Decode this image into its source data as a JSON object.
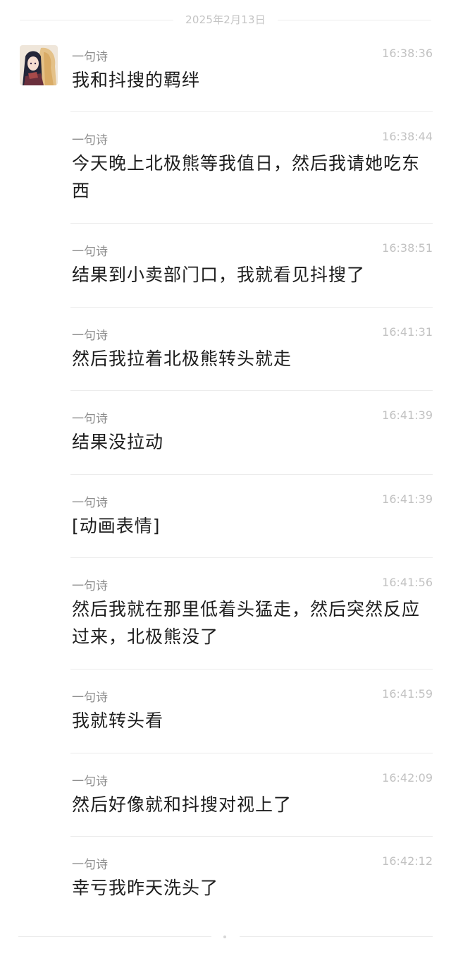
{
  "date_separator": "2025年2月13日",
  "messages": [
    {
      "sender": "一句诗",
      "time": "16:38:36",
      "text": "我和抖搜的羁绊"
    },
    {
      "sender": "一句诗",
      "time": "16:38:44",
      "text": "今天晚上北极熊等我值日，然后我请她吃东西"
    },
    {
      "sender": "一句诗",
      "time": "16:38:51",
      "text": "结果到小卖部门口，我就看见抖搜了"
    },
    {
      "sender": "一句诗",
      "time": "16:41:31",
      "text": "然后我拉着北极熊转头就走"
    },
    {
      "sender": "一句诗",
      "time": "16:41:39",
      "text": "结果没拉动"
    },
    {
      "sender": "一句诗",
      "time": "16:41:39",
      "text": "[动画表情]"
    },
    {
      "sender": "一句诗",
      "time": "16:41:56",
      "text": "然后我就在那里低着头猛走，然后突然反应过来，北极熊没了"
    },
    {
      "sender": "一句诗",
      "time": "16:41:59",
      "text": "我就转头看"
    },
    {
      "sender": "一句诗",
      "time": "16:42:09",
      "text": "然后好像就和抖搜对视上了"
    },
    {
      "sender": "一句诗",
      "time": "16:42:12",
      "text": "幸亏我昨天洗头了"
    }
  ]
}
